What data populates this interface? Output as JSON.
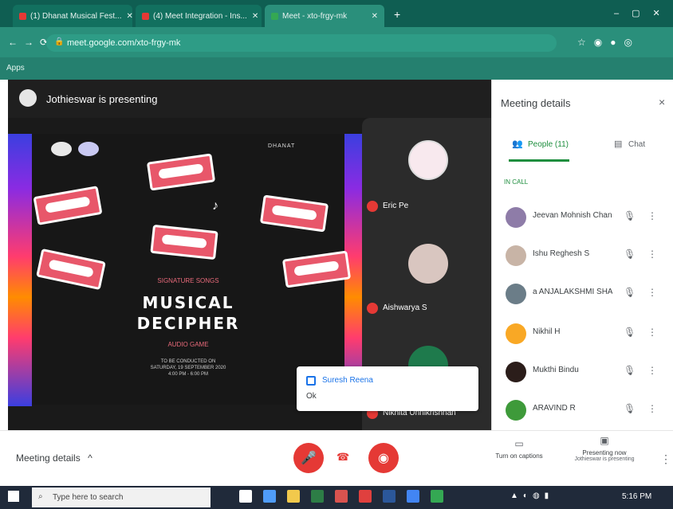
{
  "browser": {
    "tabs": [
      {
        "label": "(1) Dhanat Musical Fest...",
        "fav_color": "#e53935"
      },
      {
        "label": "(4) Meet Integration - Ins...",
        "fav_color": "#e53935"
      },
      {
        "label": "Meet - xto-frgy-mk",
        "fav_color": "#34a853"
      }
    ],
    "new_tab_label": "+",
    "url": "meet.google.com/xto-frgy-mk",
    "bookmark": "Apps"
  },
  "meet": {
    "presenter_label": "Jothieswar is presenting",
    "slide": {
      "kicker": "SIGNATURE SONGS",
      "title_line1": "MUSICAL",
      "title_line2": "DECIPHER",
      "subtitle": "AUDIO GAME",
      "details": [
        "TO BE CONDUCTED ON",
        "SATURDAY, 19 SEPTEMBER 2020",
        "4:00 PM - 6:00 PM"
      ],
      "logo_text": "DHANAT"
    },
    "tiles": [
      {
        "name": "Eric Pe",
        "avatar_color": "#f8e9ee"
      },
      {
        "name": "Aishwarya S",
        "avatar_color": "#d9c6c0"
      },
      {
        "name": "Nikhita Unnikrishnan",
        "avatar_color": "#1e7a4c"
      }
    ],
    "toast": {
      "title": "Suresh Reena",
      "subtitle": "Ok"
    },
    "panel": {
      "title": "Meeting details",
      "close": "×",
      "tab_people": "People (11)",
      "tab_chat": "Chat",
      "section_label": "IN CALL",
      "participants": [
        {
          "name": "Jeevan Mohnish Chan",
          "avatar_color": "#8e7ca8"
        },
        {
          "name": "Ishu Reghesh S",
          "avatar_color": "#c8b4a6"
        },
        {
          "name": "a ANJALAKSHMI SHAI",
          "avatar_color": "#6b7d88"
        },
        {
          "name": "Nikhil H",
          "avatar_color": "#f9a825"
        },
        {
          "name": "Mukthi Bindu",
          "avatar_color": "#2b1d1a"
        },
        {
          "name": "ARAVIND R",
          "avatar_color": "#3e9a3a"
        }
      ]
    },
    "controls": {
      "details_label": "Meeting details",
      "details_chevron": "^",
      "mic_icon": "microphone-off",
      "end_icon": "hang-up",
      "camera_icon": "camera-off",
      "captions_label": "Turn on captions",
      "present_label": "Presenting now",
      "present_sub": "Jothieswar is presenting"
    }
  },
  "taskbar": {
    "search_placeholder": "Type here to search",
    "clock": "5:16 PM"
  }
}
